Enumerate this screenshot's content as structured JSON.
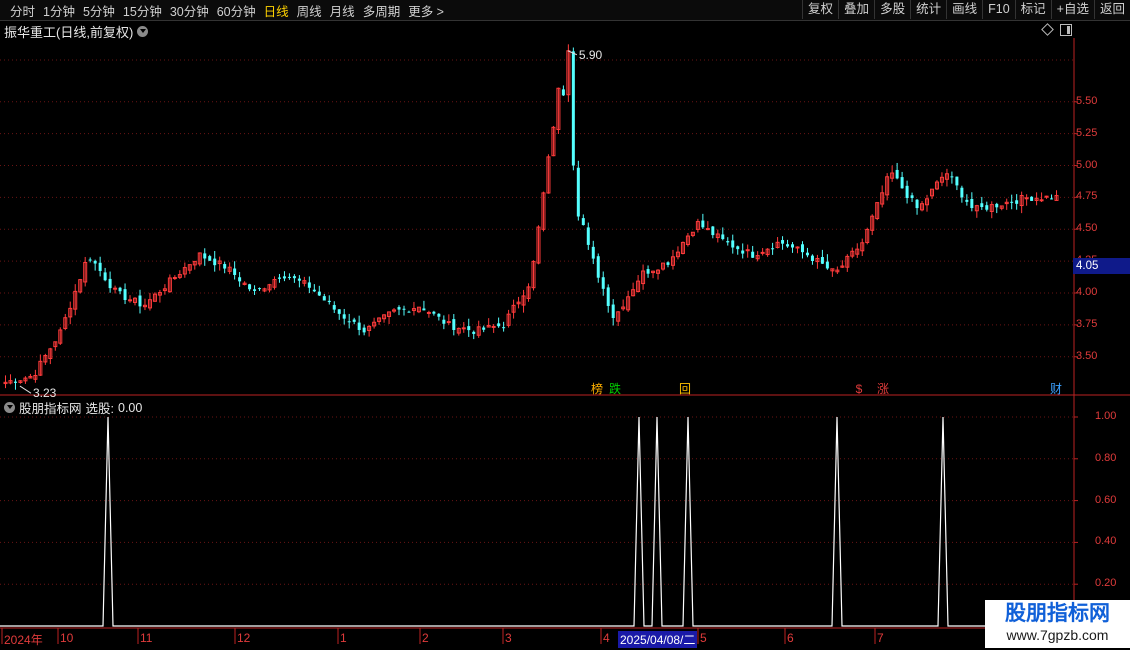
{
  "toolbar": {
    "periods": [
      "分时",
      "1分钟",
      "5分钟",
      "15分钟",
      "30分钟",
      "60分钟",
      "日线",
      "周线",
      "月线",
      "多周期",
      "更多 >"
    ],
    "active_period": "日线",
    "tools": [
      "复权",
      "叠加",
      "多股",
      "统计",
      "画线",
      "F10",
      "标记",
      "+自选",
      "返回"
    ]
  },
  "main_chart": {
    "title": "振华重工(日线,前复权)",
    "high_label": "5.90",
    "low_label": "3.23",
    "current_price": "4.05",
    "price_ticks": [
      "5.50",
      "5.25",
      "5.00",
      "4.75",
      "4.50",
      "4.25",
      "4.00",
      "3.75",
      "3.50"
    ],
    "markers": [
      {
        "text": "榜",
        "color": "#ffb000"
      },
      {
        "text": "跌",
        "color": "#00d000"
      },
      {
        "text": "回",
        "color": "#ffc000"
      },
      {
        "text": "$",
        "color": "#e03b3b"
      },
      {
        "text": "涨",
        "color": "#e03b3b"
      },
      {
        "text": "财",
        "color": "#3aa0ff"
      }
    ]
  },
  "indicator": {
    "name": "股朋指标网",
    "label": "选股:",
    "value": "0.00",
    "ticks": [
      "1.00",
      "0.80",
      "0.60",
      "0.40",
      "0.20"
    ],
    "signal_values": [
      0,
      1,
      0,
      1,
      1,
      1,
      0,
      1,
      0,
      1,
      0
    ]
  },
  "date_axis": {
    "labels": [
      "2024年",
      "10",
      "11",
      "12",
      "1",
      "2",
      "3",
      "4",
      "5",
      "6",
      "7"
    ],
    "highlight": "2025/04/08/二"
  },
  "watermark": {
    "line1": "股朋指标网",
    "line2": "www.7gpzb.com"
  },
  "chart_data": {
    "type": "candlestick",
    "title": "振华重工(日线,前复权)",
    "ylim": [
      3.2,
      6.0
    ],
    "price_range": {
      "high": 5.9,
      "low": 3.23,
      "current": 4.05
    },
    "approx_close_path": [
      3.3,
      3.35,
      3.7,
      4.3,
      4.0,
      3.9,
      4.1,
      4.3,
      4.2,
      4.0,
      4.15,
      4.05,
      3.85,
      3.7,
      3.85,
      3.9,
      3.75,
      3.7,
      3.75,
      4.1,
      5.6,
      4.4,
      3.8,
      4.15,
      4.25,
      4.55,
      4.4,
      4.3,
      4.4,
      4.3,
      4.15,
      4.4,
      4.95,
      4.65,
      4.95,
      4.65,
      4.7,
      4.75,
      4.75
    ]
  }
}
